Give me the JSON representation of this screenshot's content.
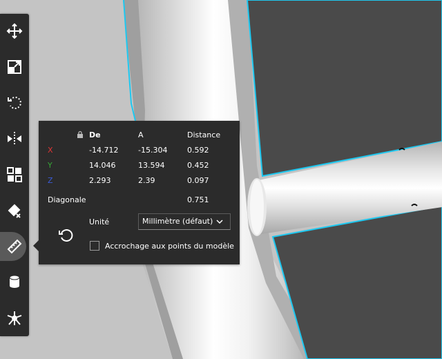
{
  "toolbar": {
    "tools": [
      {
        "name": "move-tool",
        "icon": "move-arrows-icon"
      },
      {
        "name": "scale-tool",
        "icon": "scale-icon"
      },
      {
        "name": "rotate-tool",
        "icon": "rotate-icon"
      },
      {
        "name": "mirror-tool",
        "icon": "mirror-icon"
      },
      {
        "name": "arrange-tool",
        "icon": "arrange-icon"
      },
      {
        "name": "paint-tool",
        "icon": "paint-bucket-icon"
      },
      {
        "name": "measure-tool",
        "icon": "ruler-icon",
        "active": true
      },
      {
        "name": "cylinder-tool",
        "icon": "cylinder-icon"
      },
      {
        "name": "support-tool",
        "icon": "support-tree-icon"
      }
    ]
  },
  "measure": {
    "headers": {
      "from": "De",
      "to": "A",
      "distance": "Distance"
    },
    "rows": [
      {
        "axis": "X",
        "from": "-14.712",
        "to": "-15.304",
        "distance": "0.592"
      },
      {
        "axis": "Y",
        "from": "14.046",
        "to": "13.594",
        "distance": "0.452"
      },
      {
        "axis": "Z",
        "from": "2.293",
        "to": "2.39",
        "distance": "0.097"
      }
    ],
    "diagonal_label": "Diagonale",
    "diagonal_value": "0.751",
    "unit_label": "Unité",
    "unit_value": "Millimètre (défaut)",
    "snap_label": "Accrochage aux points du modèle",
    "snap_checked": false
  },
  "colors": {
    "highlight": "#1ec8f0",
    "axis_x": "#e03535",
    "axis_y": "#36a836",
    "axis_z": "#3a5bd8"
  }
}
